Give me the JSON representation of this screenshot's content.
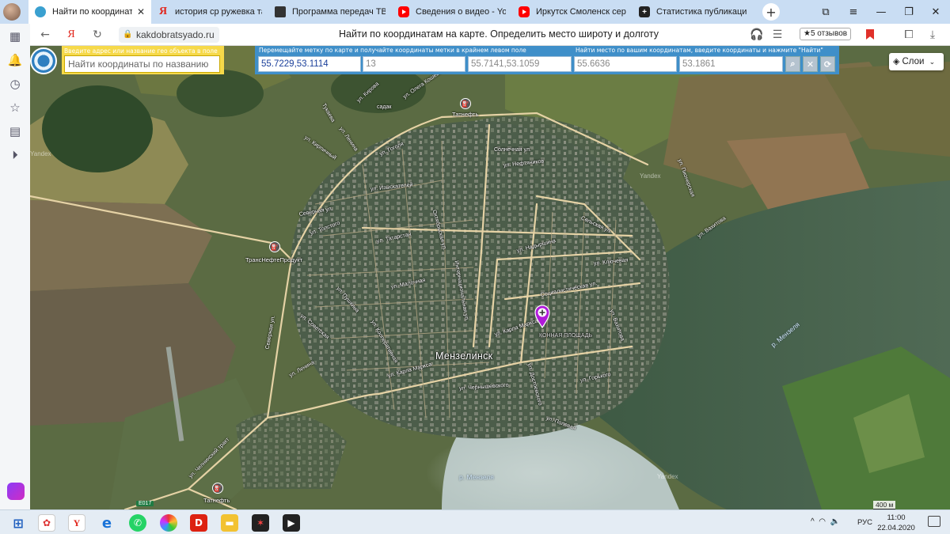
{
  "browser": {
    "tabs": [
      {
        "label": "Найти по координатам",
        "icon": "globe-icon",
        "active": true
      },
      {
        "label": "история ср ружевка тата",
        "icon": "yandex-icon"
      },
      {
        "label": "Программа передач ТВ –",
        "icon": "tv-icon"
      },
      {
        "label": "Сведения о видео - YouT",
        "icon": "youtube-icon"
      },
      {
        "label": "Иркутск Смоленск серия",
        "icon": "youtube-icon"
      },
      {
        "label": "Статистика публикаций |",
        "icon": "plus-icon"
      }
    ],
    "close_glyph": "✕",
    "new_tab_glyph": "+",
    "address": "kakdobratsyado.ru",
    "page_title": "Найти по координатам на карте. Определить место широту и долготу",
    "reviews": "★5 отзывов"
  },
  "search": {
    "hint": "Введите адрес или название гео объекта в поле",
    "placeholder": "Найти координаты по названию"
  },
  "coords": {
    "hint_move": "Перемещайте метку по карте и получайте координаты метки в крайнем левом поле",
    "marker_coords": "55.7229,53.1114",
    "zoom": "13",
    "corner_coords": "55.7141,53.1059",
    "hint_find": "Найти место по вашим координатам, введите координаты и нажмите \"Найти\"",
    "lat": "55.6636",
    "lon": "53.1861"
  },
  "layers_label": "Слои",
  "map": {
    "city": "Мензелинск",
    "river1": "р. Мензеля",
    "river2": "р. Мензеля",
    "square": "Конная площадь",
    "poi": [
      {
        "name": "Татнефть"
      },
      {
        "name": "ТрансНефтеПродукт"
      },
      {
        "name": "Татнефть"
      }
    ],
    "streets": [
      "ул. Кирова",
      "Тукаева",
      "садак",
      "ул. Олега Кошевого",
      "ул. Ленина",
      "ул. Кирпичный",
      "ул. Гоголя",
      "Солнечная ул.",
      "ул. Нефтяников",
      "Северная ул.",
      "ул. Толстого",
      "ул. Татарстан",
      "ул. Изыскателей",
      "ул. Малочная",
      "Октябрьская ул.",
      "Интернациональная ул.",
      "Сельская ул.",
      "ул. Надыршина",
      "ул. Ключевая",
      "Социалистическая ул.",
      "ул. Карла Маркса",
      "ул. Чернышевского",
      "ул. Горького",
      "ул. Полевая",
      "Северная ул.",
      "ул. Карла Маркса",
      "ул. Челнинский тракт",
      "ул. Ленина",
      "ул. Советская",
      "ул. Кооперативная",
      "ул. Пушкина",
      "ул. Вахитова",
      "ул. Достоевского",
      "ул. Пионерская",
      "ул. Вахитова"
    ],
    "watermark": "Yandex",
    "road_shield": "E017",
    "scale": "400 м"
  },
  "taskbar": {
    "lang": "РУС",
    "time": "11:00",
    "date": "22.04.2020"
  }
}
